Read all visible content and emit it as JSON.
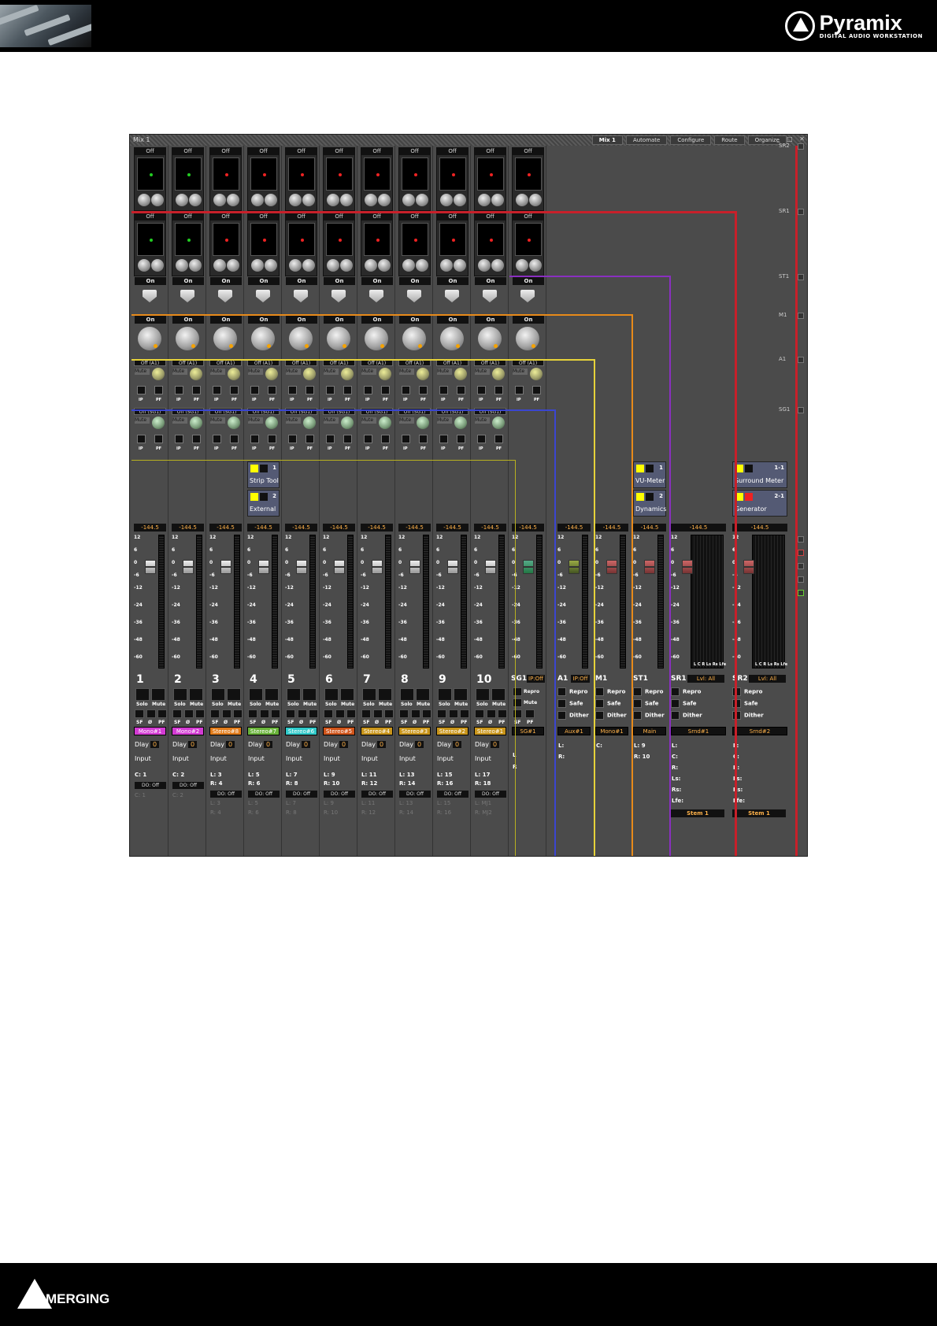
{
  "header": {
    "brand": "Pyramix",
    "subtitle": "DIGITAL AUDIO WORKSTATION"
  },
  "footer": {
    "brand": "MERGING"
  },
  "window": {
    "title": "Mix 1",
    "menu": [
      "Mix 1",
      "Automate",
      "Configure",
      "Route",
      "Organize"
    ],
    "controls": "_ □ ✕"
  },
  "bus_labels": [
    "SR2",
    "SR1",
    "ST1",
    "M1",
    "A1",
    "SG1"
  ],
  "colors": {
    "sr2": "#c8202a",
    "sr1": "#c8202a",
    "st1": "#8a2fc0",
    "m1": "#e88a1a",
    "a1": "#e6d23a",
    "sg1": "#3b46d0",
    "sg_yellow": "#b8b020"
  },
  "strips": [
    {
      "num": "1",
      "send1": "Off",
      "send2": "Off",
      "on1": "On",
      "on2": "On",
      "aux_a": "Off (A1)",
      "aux_s": "Off (SG1)",
      "mute": "Mute",
      "ip": "IP",
      "pf": "PF",
      "level": "-144.5",
      "solo": "Solo",
      "mutebtn": "Mute",
      "sf": "SF",
      "phase": "Ø",
      "pfl": "PF",
      "badge": "Mono#1",
      "badge_color": "#d33bd3",
      "dlay": "Dlay",
      "dlay_val": "0",
      "input": "Input",
      "io1": "C: 1",
      "do": "DO: Off",
      "io2": "C: 1",
      "io3": "",
      "dot": "#2c2"
    },
    {
      "num": "2",
      "send1": "Off",
      "send2": "Off",
      "on1": "On",
      "on2": "On",
      "aux_a": "Off (A1)",
      "aux_s": "Off (SG1)",
      "mute": "Mute",
      "ip": "IP",
      "pf": "PF",
      "level": "-144.5",
      "solo": "Solo",
      "mutebtn": "Mute",
      "sf": "SF",
      "phase": "Ø",
      "pfl": "PF",
      "badge": "Mono#2",
      "badge_color": "#d33bd3",
      "dlay": "Dlay",
      "dlay_val": "0",
      "input": "Input",
      "io1": "C: 2",
      "do": "DO: Off",
      "io2": "C: 2",
      "io3": "",
      "dot": "#2c2"
    },
    {
      "num": "3",
      "send1": "Off",
      "send2": "Off",
      "on1": "On",
      "on2": "On",
      "aux_a": "Off (A1)",
      "aux_s": "Off (SG1)",
      "mute": "Mute",
      "ip": "IP",
      "pf": "PF",
      "level": "-144.5",
      "solo": "Solo",
      "mutebtn": "Mute",
      "sf": "SF",
      "phase": "Ø",
      "pfl": "PF",
      "badge": "Stereo#8",
      "badge_color": "#e07b1a",
      "dlay": "Dlay",
      "dlay_val": "0",
      "input": "Input",
      "io1": "L: 3",
      "io1b": "R: 4",
      "do": "DO: Off",
      "io2": "L: 3",
      "io3": "R: 4",
      "dot": "#e22"
    },
    {
      "num": "4",
      "send1": "Off",
      "send2": "Off",
      "on1": "On",
      "on2": "On",
      "aux_a": "Off (A1)",
      "aux_s": "Off (SG1)",
      "mute": "Mute",
      "ip": "IP",
      "pf": "PF",
      "level": "-144.5",
      "solo": "Solo",
      "mutebtn": "Mute",
      "sf": "SF",
      "phase": "Ø",
      "pfl": "PF",
      "badge": "Stereo#7",
      "badge_color": "#69b33a",
      "dlay": "Dlay",
      "dlay_val": "0",
      "input": "Input",
      "io1": "L: 5",
      "io1b": "R: 6",
      "do": "DO: Off",
      "io2": "L: 5",
      "io3": "R: 6",
      "dot": "#e22"
    },
    {
      "num": "5",
      "send1": "Off",
      "send2": "Off",
      "on1": "On",
      "on2": "On",
      "aux_a": "Off (A1)",
      "aux_s": "Off (SG1)",
      "mute": "Mute",
      "ip": "IP",
      "pf": "PF",
      "level": "-144.5",
      "solo": "Solo",
      "mutebtn": "Mute",
      "sf": "SF",
      "phase": "Ø",
      "pfl": "PF",
      "badge": "Stereo#6",
      "badge_color": "#2fc9c9",
      "dlay": "Dlay",
      "dlay_val": "0",
      "input": "Input",
      "io1": "L: 7",
      "io1b": "R: 8",
      "do": "DO: Off",
      "io2": "L: 7",
      "io3": "R: 8",
      "dot": "#e22"
    },
    {
      "num": "6",
      "send1": "Off",
      "send2": "Off",
      "on1": "On",
      "on2": "On",
      "aux_a": "Off (A1)",
      "aux_s": "Off (SG1)",
      "mute": "Mute",
      "ip": "IP",
      "pf": "PF",
      "level": "-144.5",
      "solo": "Solo",
      "mutebtn": "Mute",
      "sf": "SF",
      "phase": "Ø",
      "pfl": "PF",
      "badge": "Stereo#5",
      "badge_color": "#d0541a",
      "dlay": "Dlay",
      "dlay_val": "0",
      "input": "Input",
      "io1": "L: 9",
      "io1b": "R: 10",
      "do": "DO: Off",
      "io2": "L: 9",
      "io3": "R: 10",
      "dot": "#e22"
    },
    {
      "num": "7",
      "send1": "Off",
      "send2": "Off",
      "on1": "On",
      "on2": "On",
      "aux_a": "Off (A1)",
      "aux_s": "Off (SG1)",
      "mute": "Mute",
      "ip": "IP",
      "pf": "PF",
      "level": "-144.5",
      "solo": "Solo",
      "mutebtn": "Mute",
      "sf": "SF",
      "phase": "Ø",
      "pfl": "PF",
      "badge": "Stereo#4",
      "badge_color": "#c8941a",
      "dlay": "Dlay",
      "dlay_val": "0",
      "input": "Input",
      "io1": "L: 11",
      "io1b": "R: 12",
      "do": "DO: Off",
      "io2": "L: 11",
      "io3": "R: 12",
      "dot": "#e22"
    },
    {
      "num": "8",
      "send1": "Off",
      "send2": "Off",
      "on1": "On",
      "on2": "On",
      "aux_a": "Off (A1)",
      "aux_s": "Off (SG1)",
      "mute": "Mute",
      "ip": "IP",
      "pf": "PF",
      "level": "-144.5",
      "solo": "Solo",
      "mutebtn": "Mute",
      "sf": "SF",
      "phase": "Ø",
      "pfl": "PF",
      "badge": "Stereo#3",
      "badge_color": "#c8941a",
      "dlay": "Dlay",
      "dlay_val": "0",
      "input": "Input",
      "io1": "L: 13",
      "io1b": "R: 14",
      "do": "DO: Off",
      "io2": "L: 13",
      "io3": "R: 14",
      "dot": "#e22"
    },
    {
      "num": "9",
      "send1": "Off",
      "send2": "Off",
      "on1": "On",
      "on2": "On",
      "aux_a": "Off (A1)",
      "aux_s": "Off (SG1)",
      "mute": "Mute",
      "ip": "IP",
      "pf": "PF",
      "level": "-144.5",
      "solo": "Solo",
      "mutebtn": "Mute",
      "sf": "SF",
      "phase": "Ø",
      "pfl": "PF",
      "badge": "Stereo#2",
      "badge_color": "#c8941a",
      "dlay": "Dlay",
      "dlay_val": "0",
      "input": "Input",
      "io1": "L: 15",
      "io1b": "R: 16",
      "do": "DO: Off",
      "io2": "L: 15",
      "io3": "R: 16",
      "dot": "#e22"
    },
    {
      "num": "10",
      "send1": "Off",
      "send2": "Off",
      "on1": "On",
      "on2": "On",
      "aux_a": "Off (A1)",
      "aux_s": "Off (SG1)",
      "mute": "Mute",
      "ip": "IP",
      "pf": "PF",
      "level": "-144.5",
      "solo": "Solo",
      "mutebtn": "Mute",
      "sf": "SF",
      "phase": "Ø",
      "pfl": "PF",
      "badge": "Stereo#1",
      "badge_color": "#c8941a",
      "dlay": "Dlay",
      "dlay_val": "0",
      "input": "Input",
      "io1": "L: 17",
      "io1b": "R: 18",
      "do": "DO: Off",
      "io2": "L: MJ1",
      "io3": "R: MJ2",
      "dot": "#e22"
    }
  ],
  "sg_strip": {
    "send1": "Off",
    "send2": "Off",
    "on1": "On",
    "on2": "On",
    "aux_a": "Off (A1)",
    "mute": "Mute",
    "ip": "IP",
    "pf": "PF",
    "level": "-144.5",
    "name": "SG1",
    "ipoff": "IP:Off",
    "repro": "Repro",
    "mutebtn": "Mute",
    "sf": "SF",
    "pfl": "PF",
    "badge": "SG#1",
    "l": "L",
    "r": "R"
  },
  "buses": [
    {
      "id": "a1",
      "name": "A1",
      "ipoff": "IP:Off",
      "level": "-144.5",
      "opts": [
        "Repro",
        "Safe",
        "Dither"
      ],
      "badge": "Aux#1",
      "outs": [
        "L:",
        "R:"
      ]
    },
    {
      "id": "m1",
      "name": "M1",
      "level": "-144.5",
      "opts": [
        "Repro",
        "Safe",
        "Dither"
      ],
      "badge": "Mono#1",
      "outs": [
        "C:"
      ]
    },
    {
      "id": "st1",
      "name": "ST1",
      "level": "-144.5",
      "opts": [
        "Repro",
        "Safe",
        "Dither"
      ],
      "badge": "Main",
      "outs": [
        "L: 9",
        "R: 10"
      ],
      "inserts": [
        {
          "n": "1",
          "name": "VU-Meter"
        },
        {
          "n": "2",
          "name": "Dynamics"
        }
      ]
    },
    {
      "id": "sr1",
      "name": "SR1",
      "lvl": "Lvl: All",
      "level": "-144.5",
      "opts": [
        "Repro",
        "Safe",
        "Dither"
      ],
      "badge": "Srnd#1",
      "outs": [
        "L:",
        "C:",
        "R:",
        "Ls:",
        "Rs:",
        "Lfe:"
      ],
      "stem": "Stem 1",
      "meter_lbl": "L C R Ls Rs Lfe"
    },
    {
      "id": "sr2",
      "name": "SR2",
      "lvl": "Lvl: All",
      "level": "-144.5",
      "opts": [
        "Repro",
        "Safe",
        "Dither"
      ],
      "badge": "Srnd#2",
      "outs": [
        "L:",
        "C:",
        "R:",
        "Ls:",
        "Rs:",
        "Lfe:"
      ],
      "stem": "Stem 1",
      "meter_lbl": "L C R Ls Rs Lfe",
      "inserts": [
        {
          "n": "1-1",
          "name": "Surround Meter"
        },
        {
          "n": "2-1",
          "name": "Generator"
        }
      ]
    }
  ],
  "strip_inserts": [
    {
      "n": "1",
      "name": "Strip Tool"
    },
    {
      "n": "2",
      "name": "External"
    }
  ],
  "scale": [
    "12",
    "6",
    "0",
    "-6",
    "-12",
    "-24",
    "-36",
    "-48",
    "-60"
  ]
}
